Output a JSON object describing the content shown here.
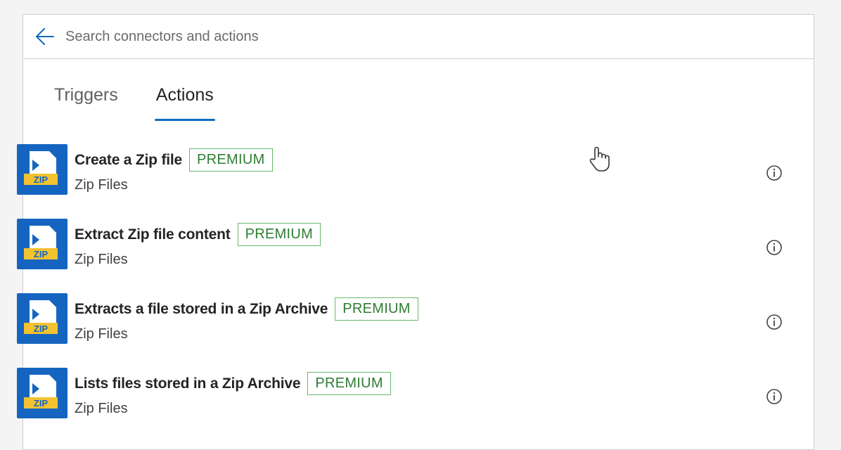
{
  "search": {
    "placeholder": "Search connectors and actions",
    "back_icon": "arrow-left-icon"
  },
  "tabs": [
    {
      "label": "Triggers",
      "active": false
    },
    {
      "label": "Actions",
      "active": true
    }
  ],
  "actions": [
    {
      "title": "Create a Zip file",
      "badge": "PREMIUM",
      "connector": "Zip Files",
      "icon": "zip-files-icon"
    },
    {
      "title": "Extract Zip file content",
      "badge": "PREMIUM",
      "connector": "Zip Files",
      "icon": "zip-files-icon"
    },
    {
      "title": "Extracts a file stored in a Zip Archive",
      "badge": "PREMIUM",
      "connector": "Zip Files",
      "icon": "zip-files-icon"
    },
    {
      "title": "Lists files stored in a Zip Archive",
      "badge": "PREMIUM",
      "connector": "Zip Files",
      "icon": "zip-files-icon"
    }
  ],
  "colors": {
    "accent": "#0f6cbd",
    "connector_icon_bg": "#1565c0",
    "zip_label_bg": "#f2c230",
    "premium_border": "#6bb86b",
    "premium_text": "#2e7d32"
  }
}
